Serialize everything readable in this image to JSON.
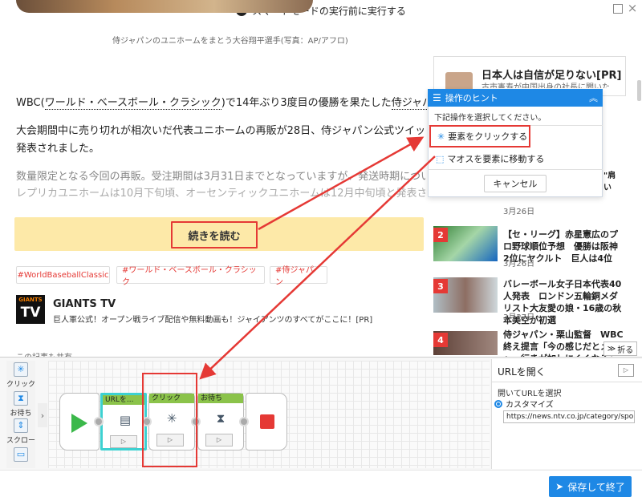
{
  "topbar": {
    "message": "スマートモードの実行前に実行する"
  },
  "article": {
    "caption": "侍ジャパンのユニホームをまとう大谷翔平選手(写真：AP/アフロ)",
    "p1_a": "WBC(",
    "p1_link": "ワールド・ベースボール・クラシック",
    "p1_b": ")で14年ぶり3度目の優勝を果たした",
    "p1_link2": "侍ジャパン",
    "p1_c": "。",
    "p2_line1": "大会期間中に売り切れが相次いだ代表ユニホームの再販が28日、侍ジャパン公式ツイッターにて",
    "p2_line2": "発表されました。",
    "p3_line1": "数量限定となる今回の再販。受注期間は3月31日までとなっていますが、発送時期については、",
    "p3_line2": "レプリカユニホームは10月下旬頃、オーセンティックユニホームは12月中旬頃と発表されていま",
    "read_more": "続きを読む",
    "tags": [
      "#WorldBaseballClassic",
      "#ワールド・ベースボール・クラシック",
      "#侍ジャパン"
    ],
    "gtv": {
      "logo_small": "GIANTS",
      "logo_big": "TV",
      "title": "GIANTS TV",
      "subtitle": "巨人軍公式！オープン戦ライブ配信や無料動画も！ジャイアンツのすべてがここに！[PR]"
    },
    "also_read": "この記事も共有"
  },
  "sidebar": {
    "ad_title": "日本人は自信が足りない[PR]",
    "ad_sub": "古市憲寿が中国出身の社長に聞いた",
    "frag_1": "\"肩",
    "frag_2": "い",
    "news": [
      {
        "rank": "",
        "title": "",
        "date": "3月26日"
      },
      {
        "rank": "2",
        "title": "【セ・リーグ】赤星憲広のプロ野球順位予想　優勝は阪神　2位にヤクルト　巨人は4位",
        "date": "3月26日"
      },
      {
        "rank": "3",
        "title": "バレーボール女子日本代表40人発表　ロンドン五輪銅メダリスト大友愛の娘・16歳の秋本美空が初選",
        "date": "3月27日"
      },
      {
        "rank": "4",
        "title": "侍ジャパン・栗山監督　WBC終え提言「今の感じだとメジャー行きが加しにくくなる」",
        "date": ""
      }
    ],
    "fold": "折る"
  },
  "hint": {
    "title": "操作のヒント",
    "desc": "下記操作を選択してください。",
    "opt1": "要素をクリックする",
    "opt2": "マオスを要素に移動する",
    "cancel": "キャンセル"
  },
  "tools": {
    "click": "クリック",
    "wait": "お待ち",
    "scroll": "スクロール"
  },
  "steps": {
    "s1": "URLを...",
    "s2": "クリック",
    "s3": "お待ち"
  },
  "props": {
    "title": "URLを開く",
    "label": "開いてURLを選択",
    "radio": "カスタマイズ",
    "url": "https://news.ntv.co.jp/category/sports/..."
  },
  "footer": {
    "save": "保存して終了"
  },
  "colors": {
    "accent": "#1e88e5",
    "highlight": "#e53935",
    "node_header": "#8bc34a",
    "selected": "#3dd1d1"
  }
}
